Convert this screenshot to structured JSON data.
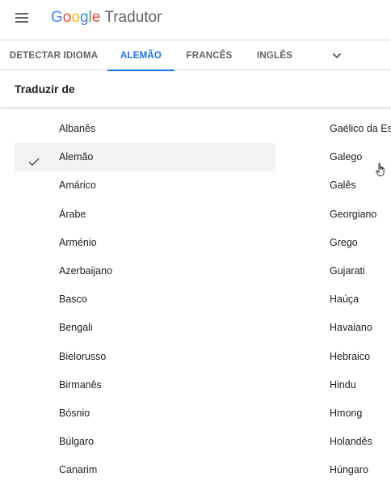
{
  "header": {
    "logo_letters": [
      {
        "ch": "G",
        "color": "#4285F4"
      },
      {
        "ch": "o",
        "color": "#EA4335"
      },
      {
        "ch": "o",
        "color": "#FBBC05"
      },
      {
        "ch": "g",
        "color": "#4285F4"
      },
      {
        "ch": "l",
        "color": "#34A853"
      },
      {
        "ch": "e",
        "color": "#EA4335"
      }
    ],
    "logo_word": "Google",
    "product_name": "Tradutor",
    "menu_icon": "hamburger-menu-icon"
  },
  "tabs": {
    "items": [
      {
        "label": "DETECTAR IDIOMA",
        "active": false
      },
      {
        "label": "ALEMÃO",
        "active": true
      },
      {
        "label": "FRANCÊS",
        "active": false
      },
      {
        "label": "INGLÊS",
        "active": false
      }
    ],
    "more_icon": "chevron-down-icon"
  },
  "section": {
    "title": "Traduzir de"
  },
  "languages": {
    "column1": [
      {
        "label": "Albanês",
        "selected": false
      },
      {
        "label": "Alemão",
        "selected": true
      },
      {
        "label": "Amárico",
        "selected": false
      },
      {
        "label": "Árabe",
        "selected": false
      },
      {
        "label": "Arménio",
        "selected": false
      },
      {
        "label": "Azerbaijano",
        "selected": false
      },
      {
        "label": "Basco",
        "selected": false
      },
      {
        "label": "Bengali",
        "selected": false
      },
      {
        "label": "Bielorusso",
        "selected": false
      },
      {
        "label": "Birmanês",
        "selected": false
      },
      {
        "label": "Bósnio",
        "selected": false
      },
      {
        "label": "Búlgaro",
        "selected": false
      },
      {
        "label": "Canarim",
        "selected": false
      }
    ],
    "column2": [
      {
        "label": "Gaélico da Esc",
        "selected": false
      },
      {
        "label": "Galego",
        "selected": false
      },
      {
        "label": "Galês",
        "selected": false
      },
      {
        "label": "Georgiano",
        "selected": false
      },
      {
        "label": "Grego",
        "selected": false
      },
      {
        "label": "Gujarati",
        "selected": false
      },
      {
        "label": "Haúça",
        "selected": false
      },
      {
        "label": "Havaiano",
        "selected": false
      },
      {
        "label": "Hebraico",
        "selected": false
      },
      {
        "label": "Hindu",
        "selected": false
      },
      {
        "label": "Hmong",
        "selected": false
      },
      {
        "label": "Holandês",
        "selected": false
      },
      {
        "label": "Húngaro",
        "selected": false
      }
    ],
    "selected_icon": "check-icon"
  },
  "colors": {
    "accent": "#1a73e8",
    "text": "#202124",
    "muted": "#5f6368",
    "selected_bg": "#f1f3f4"
  }
}
